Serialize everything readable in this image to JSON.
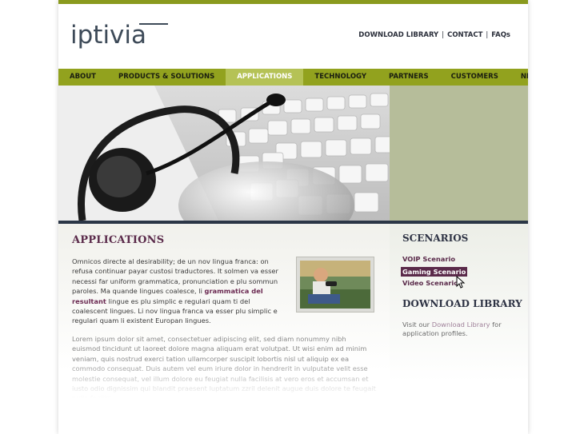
{
  "brand": {
    "logo_text": "iptivia"
  },
  "toplinks": {
    "download_library": "DOWNLOAD LIBRARY",
    "contact": "CONTACT",
    "faqs": "FAQs",
    "separator": "|"
  },
  "nav": {
    "items": [
      {
        "label": "ABOUT"
      },
      {
        "label": "PRODUCTS & SOLUTIONS"
      },
      {
        "label": "APPLICATIONS"
      },
      {
        "label": "TECHNOLOGY"
      },
      {
        "label": "PARTNERS"
      },
      {
        "label": "CUSTOMERS"
      },
      {
        "label": "NEWS & EVENTS"
      }
    ],
    "active_index": 2
  },
  "main": {
    "heading": "APPLICATIONS",
    "intro_part1": "Omnicos directe al desirability; de un nov lingua franca: on refusa continuar payar custosi traductores. It solmen va esser necessi far uniform grammatica, pronunciation e plu sommun paroles. Ma quande lingues coalesce, li ",
    "intro_highlight": "grammatica del resultant",
    "intro_part2": " lingue es plu simplic e regulari quam ti del coalescent lingues. Li nov lingua franca va esser plu simplic e regulari quam li existent Europan lingues.",
    "lorem": "Lorem ipsum dolor sit amet, consectetuer adipiscing elit, sed diam nonummy nibh euismod tincidunt ut laoreet dolore magna aliquam erat volutpat. Ut wisi enim ad minim veniam, quis nostrud exerci tation ullamcorper suscipit lobortis nisl ut aliquip ex ea commodo consequat. Duis autem vel eum iriure dolor in hendrerit in vulputate velit esse molestie consequat, vel illum dolore eu feugiat nulla facilisis at vero eros et accumsan et iusto odio dignissim qui blandit praesent luptatum zzril delenit augue duis dolore te feugait nulla facilisi."
  },
  "sidebar": {
    "scenarios_title": "SCENARIOS",
    "scenarios": [
      {
        "label": "VOIP Scenario"
      },
      {
        "label": "Gaming Scenario"
      },
      {
        "label": "Video Scenario"
      }
    ],
    "active_scenario_index": 1,
    "download_title": "DOWNLOAD LIBRARY",
    "download_text_pre": "Visit our ",
    "download_link": "Download Library",
    "download_text_post": " for application profiles."
  },
  "colors": {
    "nav_bg": "#92a21e",
    "nav_active": "#b5c256",
    "accent": "#5a2a4a",
    "hero_side": "#b6bd9a"
  }
}
